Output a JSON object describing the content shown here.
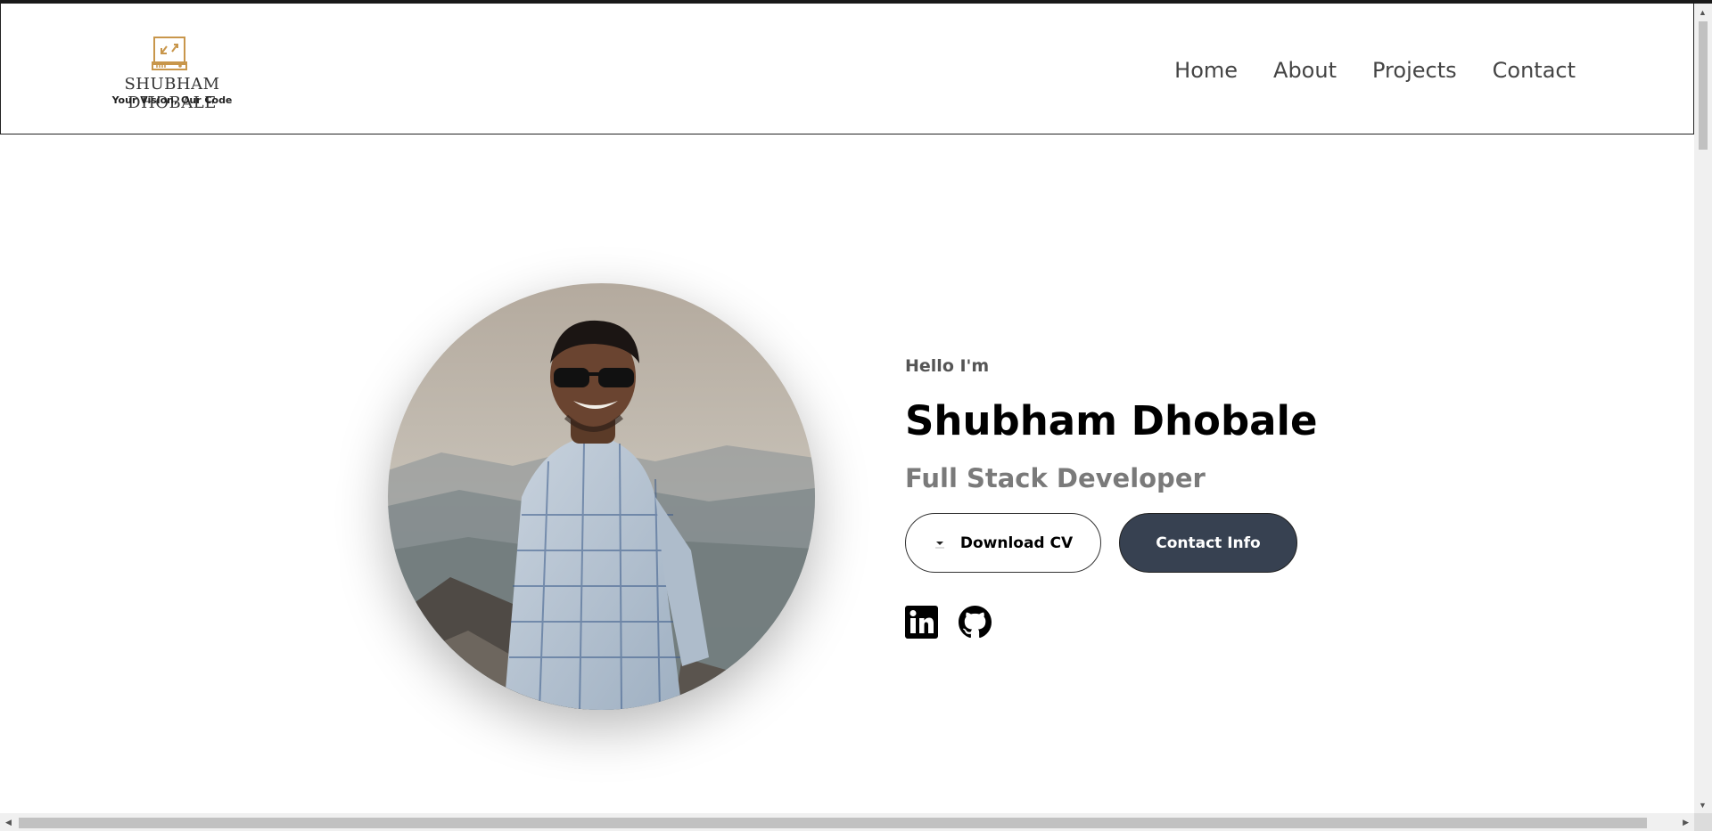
{
  "brand": {
    "name": "SHUBHAM DHOBALE",
    "tagline": "Your Vision, Our Code"
  },
  "nav": {
    "items": [
      {
        "label": "Home"
      },
      {
        "label": "About"
      },
      {
        "label": "Projects"
      },
      {
        "label": "Contact"
      }
    ]
  },
  "hero": {
    "greeting": "Hello I'm",
    "name": "Shubham Dhobale",
    "role": "Full Stack Developer",
    "download_label": "Download CV",
    "contact_label": "Contact Info",
    "contact_button_color": "#374151"
  },
  "socials": [
    {
      "icon": "linkedin-icon"
    },
    {
      "icon": "github-icon"
    }
  ]
}
